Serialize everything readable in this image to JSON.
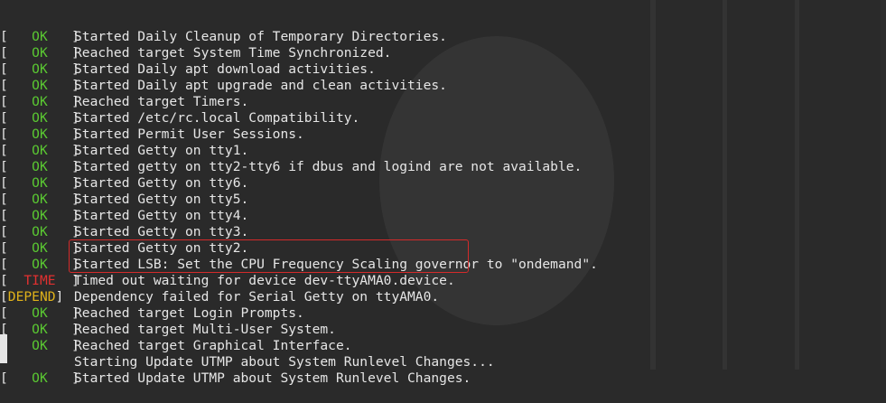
{
  "colors": {
    "background": "#2a2a2a",
    "text": "#e6e6e6",
    "ok": "#5ac832",
    "time": "#e23030",
    "depend": "#e0b21a",
    "highlight_box": "#d42a2a"
  },
  "lines": [
    {
      "open": "[",
      "tag": "  OK  ",
      "close": "]",
      "status": "ok",
      "msg": "Started Daily Cleanup of Temporary Directories."
    },
    {
      "open": "[",
      "tag": "  OK  ",
      "close": "]",
      "status": "ok",
      "msg": "Reached target System Time Synchronized."
    },
    {
      "open": "[",
      "tag": "  OK  ",
      "close": "]",
      "status": "ok",
      "msg": "Started Daily apt download activities."
    },
    {
      "open": "[",
      "tag": "  OK  ",
      "close": "]",
      "status": "ok",
      "msg": "Started Daily apt upgrade and clean activities."
    },
    {
      "open": "[",
      "tag": "  OK  ",
      "close": "]",
      "status": "ok",
      "msg": "Reached target Timers."
    },
    {
      "open": "[",
      "tag": "  OK  ",
      "close": "]",
      "status": "ok",
      "msg": "Started /etc/rc.local Compatibility."
    },
    {
      "open": "[",
      "tag": "  OK  ",
      "close": "]",
      "status": "ok",
      "msg": "Started Permit User Sessions."
    },
    {
      "open": "[",
      "tag": "  OK  ",
      "close": "]",
      "status": "ok",
      "msg": "Started Getty on tty1."
    },
    {
      "open": "[",
      "tag": "  OK  ",
      "close": "]",
      "status": "ok",
      "msg": "Started getty on tty2-tty6 if dbus and logind are not available."
    },
    {
      "open": "[",
      "tag": "  OK  ",
      "close": "]",
      "status": "ok",
      "msg": "Started Getty on tty6."
    },
    {
      "open": "[",
      "tag": "  OK  ",
      "close": "]",
      "status": "ok",
      "msg": "Started Getty on tty5."
    },
    {
      "open": "[",
      "tag": "  OK  ",
      "close": "]",
      "status": "ok",
      "msg": "Started Getty on tty4."
    },
    {
      "open": "[",
      "tag": "  OK  ",
      "close": "]",
      "status": "ok",
      "msg": "Started Getty on tty3."
    },
    {
      "open": "[",
      "tag": "  OK  ",
      "close": "]",
      "status": "ok",
      "msg": "Started Getty on tty2."
    },
    {
      "open": "[",
      "tag": "  OK  ",
      "close": "]",
      "status": "ok",
      "msg": "Started LSB: Set the CPU Frequency Scaling governor to \"ondemand\"."
    },
    {
      "open": "[",
      "tag": " TIME ",
      "close": "]",
      "status": "time",
      "msg": "Timed out waiting for device dev-ttyAMA0.device."
    },
    {
      "open": "[",
      "tag": "DEPEND",
      "close": "]",
      "status": "depend",
      "msg": "Dependency failed for Serial Getty on ttyAMA0."
    },
    {
      "open": "[",
      "tag": "  OK  ",
      "close": "]",
      "status": "ok",
      "msg": "Reached target Login Prompts."
    },
    {
      "open": "[",
      "tag": "  OK  ",
      "close": "]",
      "status": "ok",
      "msg": "Reached target Multi-User System."
    },
    {
      "open": "[",
      "tag": "  OK  ",
      "close": "]",
      "status": "ok",
      "msg": "Reached target Graphical Interface."
    },
    {
      "open": "",
      "tag": "",
      "close": "",
      "status": "none",
      "msg": "Starting Update UTMP about System Runlevel Changes..."
    },
    {
      "open": "[",
      "tag": "  OK  ",
      "close": "]",
      "status": "ok",
      "msg": "Started Update UTMP about System Runlevel Changes."
    }
  ]
}
